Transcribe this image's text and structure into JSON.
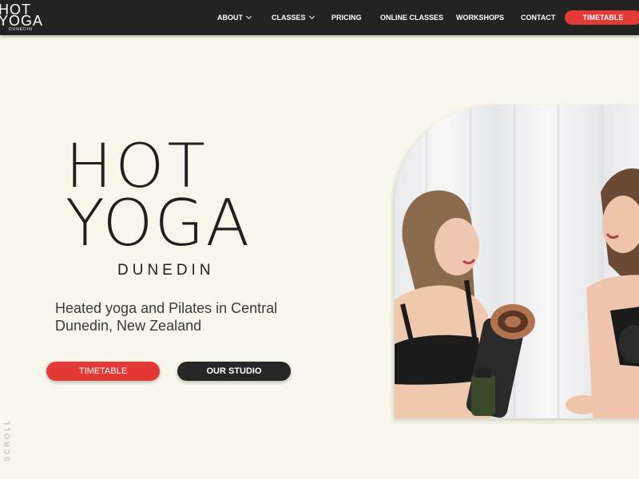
{
  "nav": {
    "logo_line1": "HOT",
    "logo_line2": "YOGA",
    "logo_line3": "DUNEDIN",
    "items": [
      {
        "label": "ABOUT",
        "has_dropdown": true
      },
      {
        "label": "CLASSES",
        "has_dropdown": true
      },
      {
        "label": "PRICING",
        "has_dropdown": false
      },
      {
        "label": "ONLINE CLASSES",
        "has_dropdown": false
      },
      {
        "label": "WORKSHOPS",
        "has_dropdown": false
      },
      {
        "label": "CONTACT",
        "has_dropdown": false
      }
    ],
    "cta_label": "TIMETABLE"
  },
  "hero": {
    "title_line1": "HOT",
    "title_line2": "YOGA",
    "subtitle": "DUNEDIN",
    "tagline": "Heated yoga and Pilates in Central Dunedin, New Zealand",
    "primary_button": "TIMETABLE",
    "secondary_button": "OUR STUDIO",
    "scroll_label": "SCROLL"
  },
  "colors": {
    "background": "#f8f6ea",
    "nav_background": "#232323",
    "accent_red": "#e33a36",
    "dark_button": "#262626",
    "text_dark": "#1f1f1f"
  }
}
